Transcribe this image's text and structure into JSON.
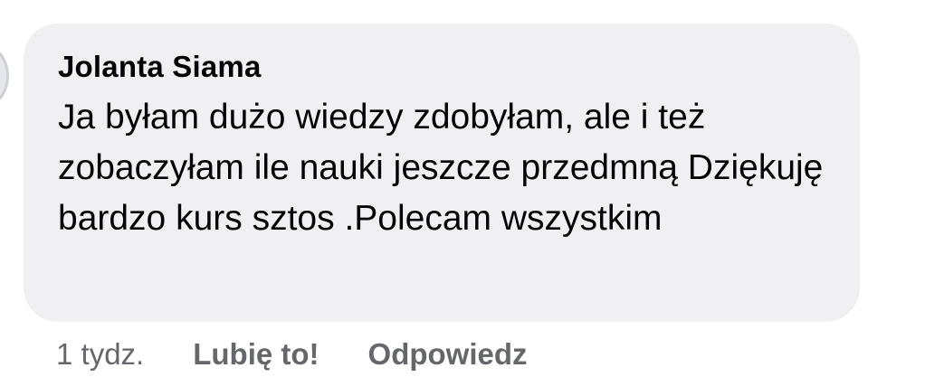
{
  "comment": {
    "author": "Jolanta Siama",
    "text": "Ja byłam dużo wiedzy zdobyłam, ale i też zobaczyłam ile nauki jeszcze przedmną Dziękuję bardzo kurs sztos .Polecam wszystkim"
  },
  "actions": {
    "timestamp": "1 tydz.",
    "like_label": "Lubię to!",
    "reply_label": "Odpowiedz"
  },
  "colors": {
    "bubble_bg": "#f0f0f3",
    "text": "#050505",
    "secondary_text": "#65676b"
  }
}
